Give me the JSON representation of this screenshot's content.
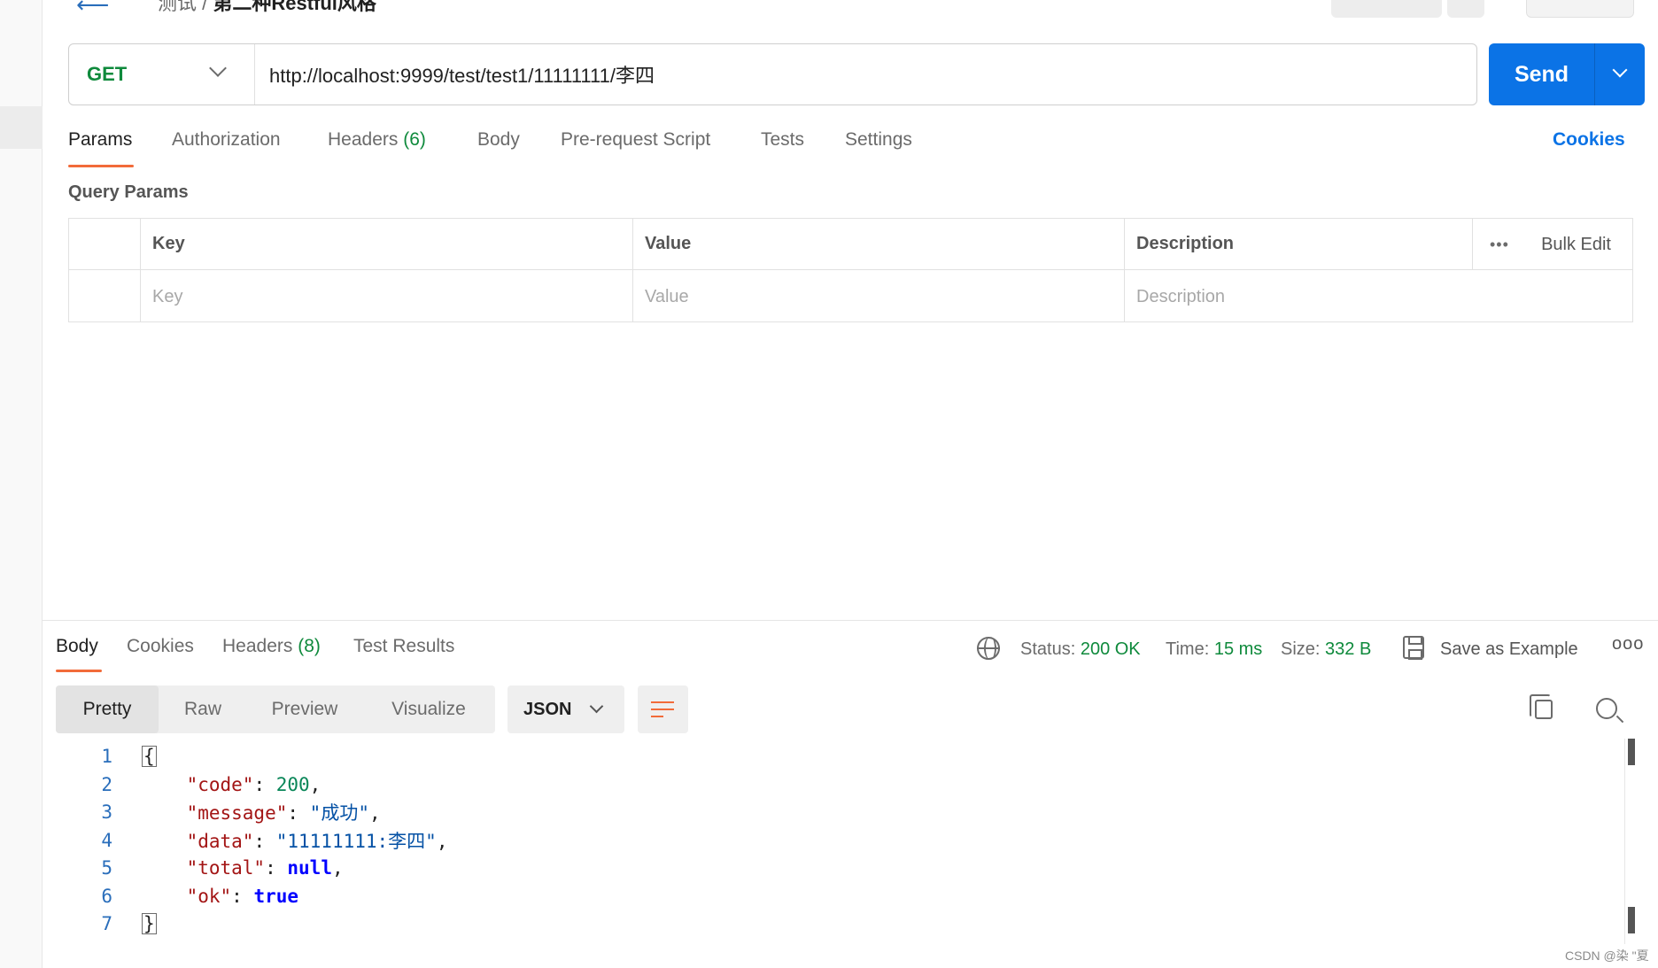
{
  "topbar": {
    "breadcrumb_parent": "测试",
    "breadcrumb_current": "第二种Restful风格"
  },
  "request": {
    "method": "GET",
    "url": "http://localhost:9999/test/test1/11111111/李四",
    "send_label": "Send"
  },
  "request_tabs": [
    {
      "label": "Params"
    },
    {
      "label": "Authorization"
    },
    {
      "label": "Headers",
      "count": "(6)"
    },
    {
      "label": "Body"
    },
    {
      "label": "Pre-request Script"
    },
    {
      "label": "Tests"
    },
    {
      "label": "Settings"
    }
  ],
  "cookies_link": "Cookies",
  "query_params": {
    "title": "Query Params",
    "headers": [
      "Key",
      "Value",
      "Description"
    ],
    "bulk_edit": "Bulk Edit",
    "placeholders": [
      "Key",
      "Value",
      "Description"
    ]
  },
  "response_tabs": [
    {
      "label": "Body"
    },
    {
      "label": "Cookies"
    },
    {
      "label": "Headers",
      "count": "(8)"
    },
    {
      "label": "Test Results"
    }
  ],
  "response_status": {
    "status_label": "Status:",
    "status_value": "200 OK",
    "time_label": "Time:",
    "time_value": "15 ms",
    "size_label": "Size:",
    "size_value": "332 B",
    "save_example": "Save as Example"
  },
  "view_modes": [
    "Pretty",
    "Raw",
    "Preview",
    "Visualize"
  ],
  "format": "JSON",
  "code_lines": [
    {
      "n": "1"
    },
    {
      "n": "2",
      "key": "\"code\"",
      "value": "200",
      "type": "number"
    },
    {
      "n": "3",
      "key": "\"message\"",
      "value": "\"成功\"",
      "type": "string"
    },
    {
      "n": "4",
      "key": "\"data\"",
      "value": "\"11111111:李四\"",
      "type": "string"
    },
    {
      "n": "5",
      "key": "\"total\"",
      "value": "null",
      "type": "keyword"
    },
    {
      "n": "6",
      "key": "\"ok\"",
      "value": "true",
      "type": "keyword"
    },
    {
      "n": "7"
    }
  ],
  "watermark": "CSDN @染 \"夏",
  "colors": {
    "accent_orange": "#f26b3a",
    "send_blue": "#0b73e6",
    "success_green": "#0f8a3c"
  }
}
